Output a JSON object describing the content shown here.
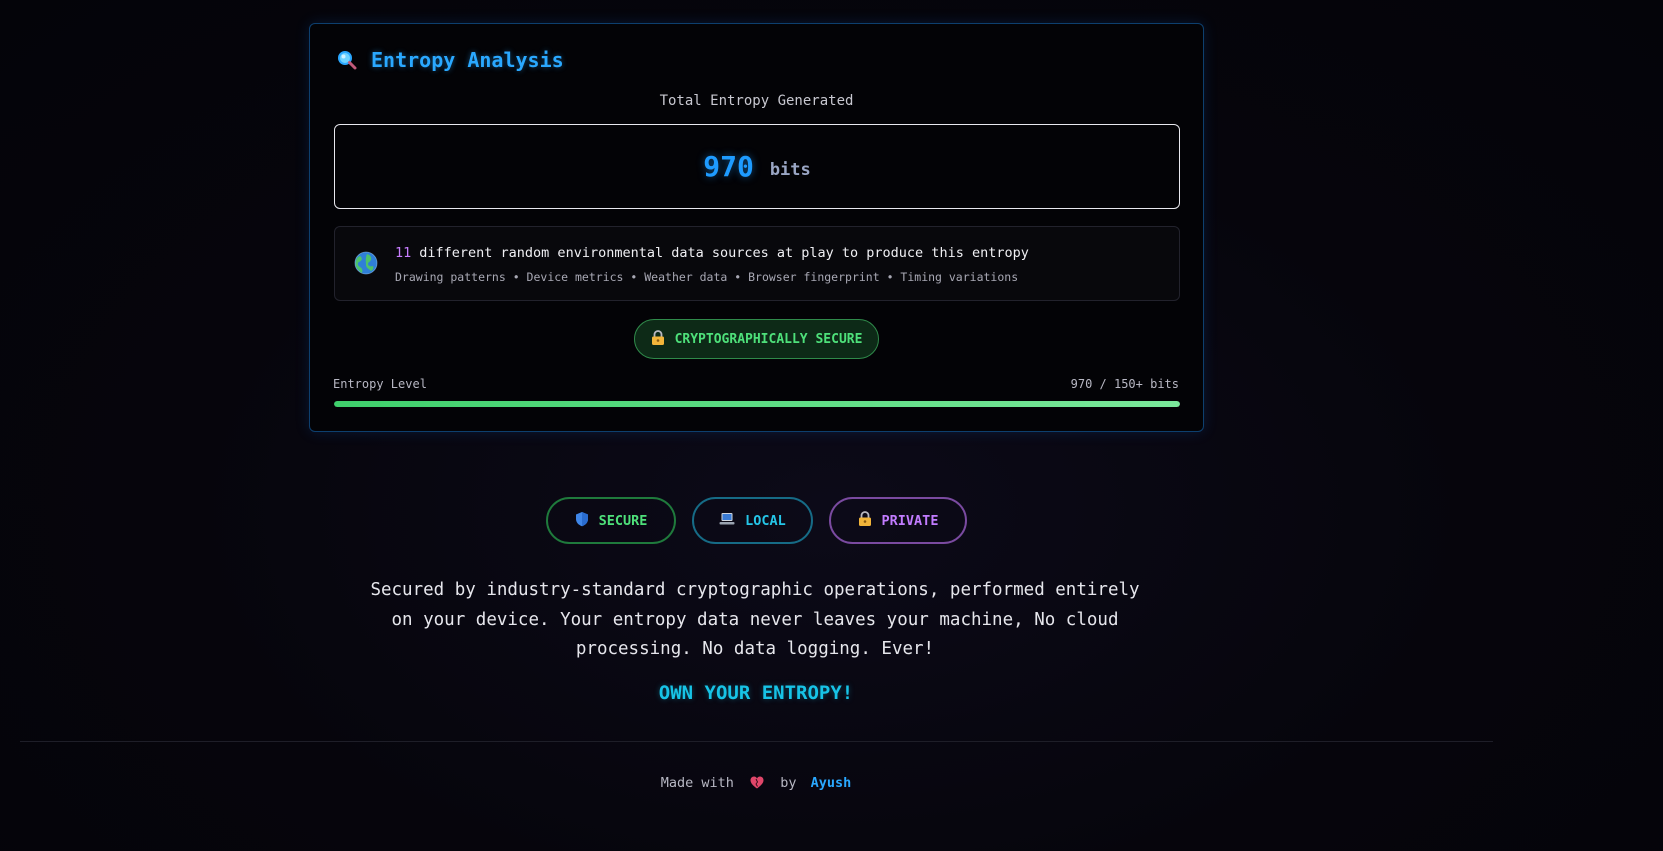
{
  "card": {
    "title": "Entropy Analysis",
    "title_icon": "magnifying-glass-icon",
    "total_label": "Total Entropy Generated",
    "total_value": "970",
    "total_unit": "bits",
    "sources": {
      "icon": "globe-icon",
      "count": "11",
      "text": "different random environmental data sources at play to produce this entropy",
      "list": "Drawing patterns • Device metrics • Weather data • Browser fingerprint • Timing variations"
    },
    "badge": {
      "icon": "lock-icon",
      "label": "CRYPTOGRAPHICALLY SECURE"
    },
    "level": {
      "label": "Entropy Level",
      "value_text": "970 / 150+ bits",
      "fill_fraction": 1.0
    }
  },
  "pills": {
    "secure": {
      "icon": "shield-icon",
      "label": "SECURE"
    },
    "local": {
      "icon": "laptop-icon",
      "label": "LOCAL"
    },
    "private": {
      "icon": "lock-icon",
      "label": "PRIVATE"
    }
  },
  "tagline": "Secured by industry-standard cryptographic operations, performed entirely on your device. Your entropy data never leaves your machine, No cloud processing. No data logging. Ever!",
  "own": "OWN YOUR ENTROPY!",
  "footer": {
    "prefix": "Made with",
    "heart_icon": "heart-icon",
    "by": "by",
    "author": "Ayush"
  },
  "colors": {
    "accent_blue": "#2aa8ff",
    "green": "#4ee07a",
    "cyan": "#17c3e6",
    "purple": "#c27cff"
  }
}
